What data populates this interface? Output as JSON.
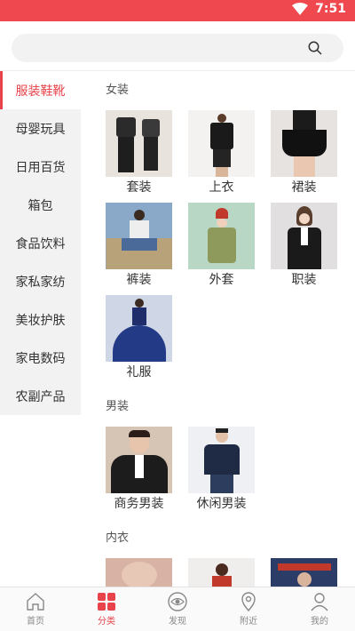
{
  "status": {
    "time": "7:51",
    "accent": "#f0484f"
  },
  "search": {
    "placeholder": ""
  },
  "sidebar": {
    "items": [
      {
        "label": "服装鞋靴"
      },
      {
        "label": "母婴玩具"
      },
      {
        "label": "日用百货"
      },
      {
        "label": "箱包"
      },
      {
        "label": "食品饮料"
      },
      {
        "label": "家私家纺"
      },
      {
        "label": "美妆护肤"
      },
      {
        "label": "家电数码"
      },
      {
        "label": "农副产品"
      }
    ]
  },
  "sections": [
    {
      "title": "女装",
      "items": [
        {
          "label": "套装",
          "bg": "#e8e3dc"
        },
        {
          "label": "上衣",
          "bg": "#f4f2f1"
        },
        {
          "label": "裙装",
          "bg": "#e7e3e1"
        },
        {
          "label": "裤装",
          "bg": "#8aa8c8"
        },
        {
          "label": "外套",
          "bg": "#b9d7c5"
        },
        {
          "label": "职装",
          "bg": "#e2dfe0"
        },
        {
          "label": "礼服",
          "bg": "#cfd7e6"
        }
      ]
    },
    {
      "title": "男装",
      "items": [
        {
          "label": "商务男装",
          "bg": "#d6c4b4"
        },
        {
          "label": "休闲男装",
          "bg": "#eef0f3"
        }
      ]
    },
    {
      "title": "内衣",
      "items": [
        {
          "label": "",
          "bg": "#d8b2a5"
        },
        {
          "label": "",
          "bg": "#f0eded"
        },
        {
          "label": "",
          "bg": "#2b3d66"
        }
      ]
    }
  ],
  "nav": [
    {
      "label": "首页",
      "icon": "home-icon"
    },
    {
      "label": "分类",
      "icon": "category-icon"
    },
    {
      "label": "发现",
      "icon": "eye-icon"
    },
    {
      "label": "附近",
      "icon": "location-icon"
    },
    {
      "label": "我的",
      "icon": "user-icon"
    }
  ]
}
